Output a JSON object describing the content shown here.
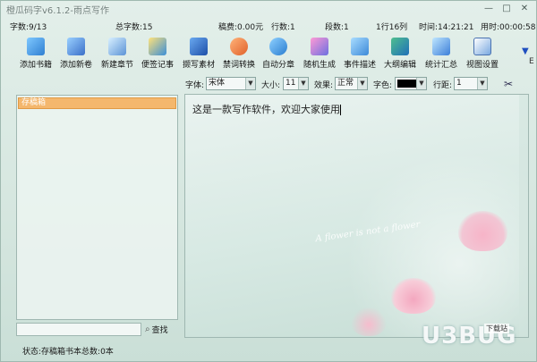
{
  "window": {
    "title": "橙瓜码字v6.1.2-雨点写作",
    "controls": [
      "—",
      "□",
      "✕"
    ]
  },
  "stats": {
    "word_count": "字数:9/13",
    "total_words": "总字数:15",
    "royalty": "稿费:0.00元",
    "lines": "行数:1",
    "paragraphs": "段数:1",
    "position": "1行16列",
    "time": "时间:14:21:21",
    "elapsed": "用时:00:00:58"
  },
  "toolbar": {
    "items": [
      {
        "label": "添加书籍",
        "icon": "add-book-icon"
      },
      {
        "label": "添加新卷",
        "icon": "add-volume-icon"
      },
      {
        "label": "新建章节",
        "icon": "new-chapter-icon"
      },
      {
        "label": "便签记事",
        "icon": "sticky-note-icon"
      },
      {
        "label": "撷写素材",
        "icon": "material-icon"
      },
      {
        "label": "禁词转换",
        "icon": "convert-icon"
      },
      {
        "label": "自动分章",
        "icon": "split-chapter-icon"
      },
      {
        "label": "随机生成",
        "icon": "random-generate-icon"
      },
      {
        "label": "事件描述",
        "icon": "event-folder-icon"
      },
      {
        "label": "大纲编辑",
        "icon": "outline-book-icon"
      },
      {
        "label": "统计汇总",
        "icon": "statistics-icon"
      },
      {
        "label": "视图设置",
        "icon": "view-settings-icon"
      }
    ],
    "more": "▼",
    "edge_text": "E"
  },
  "format": {
    "font_label": "字体:",
    "font_value": "宋体",
    "size_label": "大小:",
    "size_value": "11",
    "effect_label": "效果:",
    "effect_value": "正常",
    "color_label": "字色:",
    "line_spacing_label": "行距:",
    "line_spacing_value": "1",
    "arrow": "▼",
    "scissors": "✂"
  },
  "tree": {
    "root": "存稿箱"
  },
  "search": {
    "value": "",
    "button": "查找"
  },
  "editor": {
    "content": "这是一款写作软件，欢迎大家使用",
    "decoration_text": "A flower is not a flower"
  },
  "status": {
    "text": "状态:存稿箱书本总数:0本"
  },
  "watermark": {
    "text": "U3BUG",
    "sub": "下载站"
  },
  "colors": {
    "accent_orange": "#f4b76d",
    "text_color_swatch": "#000000"
  }
}
